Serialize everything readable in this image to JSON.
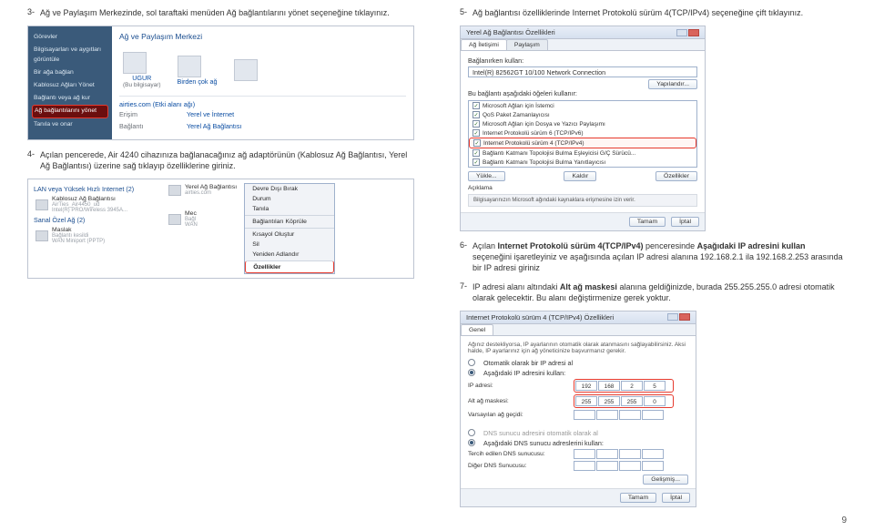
{
  "page_number": "9",
  "left": {
    "steps": {
      "s3": {
        "num": "3-",
        "text": "Ağ ve Paylaşım Merkezinde, sol taraftaki menüden Ağ bağlantılarını yönet seçeneğine tıklayınız."
      },
      "s4": {
        "num": "4-",
        "text": "Açılan pencerede, Air 4240 cihazınıza bağlanacağınız ağ adaptörünün (Kablosuz Ağ Bağlantısı, Yerel Ağ Bağlantısı) üzerine sağ tıklayıp özelliklerine giriniz."
      }
    },
    "ss1": {
      "title": "Ağ ve Paylaşım Merkezi",
      "sidebar": {
        "a": "Görevler",
        "b": "Bilgisayarları ve aygıtları görüntüle",
        "c": "Bir ağa bağlan",
        "d": "Kablosuz Ağları Yönet",
        "e": "Bağlantı veya ağ kur",
        "f": "Ağ bağlantılarını yönet",
        "g": "Tanıla ve onar"
      },
      "host": {
        "name": "UGUR",
        "sub": "(Bu bilgisayar)"
      },
      "link": {
        "name": "airties.com (Etki alanı ağı)"
      },
      "multi": "Birden çok ağ",
      "rows": {
        "erisim": {
          "label": "Erişim",
          "val": "Yerel ve İnternet"
        },
        "baglanti": {
          "label": "Bağlantı",
          "val": "Yerel Ağ Bağlantısı"
        }
      }
    },
    "ss2": {
      "lan_h": "LAN veya Yüksek Hızlı Internet (2)",
      "wlan": {
        "name": "Kablosuz Ağ Bağlantısı",
        "sub1": "AirTies_Air4450_ud",
        "sub2": "Intel(R) PRO/Wireless 3945A..."
      },
      "lan": {
        "name": "Yerel Ağ Bağlantısı",
        "sub": "airties.com"
      },
      "so_h": "Sanal Özel Ağ (2)",
      "maslak": {
        "name": "Maslak",
        "sub1": "Bağlantı kesildi",
        "sub2": "WAN Miniport (PPTP)"
      },
      "mec": {
        "name": "Mec",
        "sub1": "Bağl",
        "sub2": "WAN"
      },
      "ctx": {
        "a": "Devre Dışı Bırak",
        "b": "Durum",
        "c": "Tanıla",
        "d": "Bağlantıları Köprüle",
        "e": "Kısayol Oluştur",
        "f": "Sil",
        "g": "Yeniden Adlandır",
        "h": "Özellikler"
      }
    }
  },
  "right": {
    "steps": {
      "s5": {
        "num": "5-",
        "text": "Ağ bağlantısı özelliklerinde Internet Protokolü sürüm 4(TCP/IPv4) seçeneğine çift tıklayınız."
      },
      "s6": {
        "num": "6-",
        "prefix": "Açılan ",
        "bold1": "Internet Protokolü sürüm 4(TCP/IPv4)",
        "mid1": " penceresinde ",
        "bold2": "Aşağıdaki IP adresini kullan",
        "mid2": " seçeneğini işaretleyiniz ve aşağısında açılan IP adresi alanına 192.168.2.1 ila 192.168.2.253 arasında bir IP adresi giriniz"
      },
      "s7": {
        "num": "7-",
        "prefix": "IP adresi alanı altındaki ",
        "bold1": "Alt ağ maskesi",
        "mid1": " alanına geldiğinizde, burada 255.255.255.0 adresi otomatik olarak gelecektir. Bu alanı değiştirmenize gerek yoktur."
      }
    },
    "ss3": {
      "title": "Yerel Ağ Bağlantısı Özellikleri",
      "tab1": "Ağ İletişimi",
      "tab2": "Paylaşım",
      "conn_label": "Bağlanırken kullan:",
      "adapter": "Intel(R) 82562GT 10/100 Network Connection",
      "yapil": "Yapılandır...",
      "list_label": "Bu bağlantı aşağıdaki öğeleri kullanır:",
      "items": {
        "a": "Microsoft Ağları için İstemci",
        "b": "QoS Paket Zamanlayıcısı",
        "c": "Microsoft Ağları için Dosya ve Yazıcı Paylaşımı",
        "d": "Internet Protokolü sürüm 6 (TCP/IPv6)",
        "e": "Internet Protokolü sürüm 4 (TCP/IPv4)",
        "f": "Bağlantı Katmanı Topolojisi Bulma Eşleyicisi G/Ç Sürücü...",
        "g": "Bağlantı Katmanı Topolojisi Bulma Yanıtlayıcısı"
      },
      "btns": {
        "yukle": "Yükle...",
        "kaldir": "Kaldır",
        "ozel": "Özellikler"
      },
      "desc_h": "Açıklama",
      "desc": "Bilgisayarınızın Microsoft ağındaki kaynaklara erişmesine izin verir.",
      "ok": "Tamam",
      "cancel": "İptal"
    },
    "ss4": {
      "title": "Internet Protokolü sürüm 4 (TCP/IPv4) Özellikleri",
      "tab": "Genel",
      "intro": "Ağınız destekliyorsa, IP ayarlarının otomatik olarak atanmasını sağlayabilirsiniz. Aksi halde, IP ayarlarınız için ağ yöneticinize başvurmanız gerekir.",
      "r1": "Otomatik olarak bir IP adresi al",
      "r2": "Aşağıdaki IP adresini kullan:",
      "ip_l": "IP adresi:",
      "mask_l": "Alt ağ maskesi:",
      "gw_l": "Varsayılan ağ geçidi:",
      "ip": {
        "a": "192",
        "b": "168",
        "c": "2",
        "d": "5"
      },
      "mask": {
        "a": "255",
        "b": "255",
        "c": "255",
        "d": "0"
      },
      "r3": "DNS sunucu adresini otomatik olarak al",
      "r4": "Aşağıdaki DNS sunucu adreslerini kullan:",
      "dns1_l": "Tercih edilen DNS sunucusu:",
      "dns2_l": "Diğer DNS Sunucusu:",
      "adv": "Gelişmiş...",
      "ok": "Tamam",
      "cancel": "İptal"
    }
  }
}
